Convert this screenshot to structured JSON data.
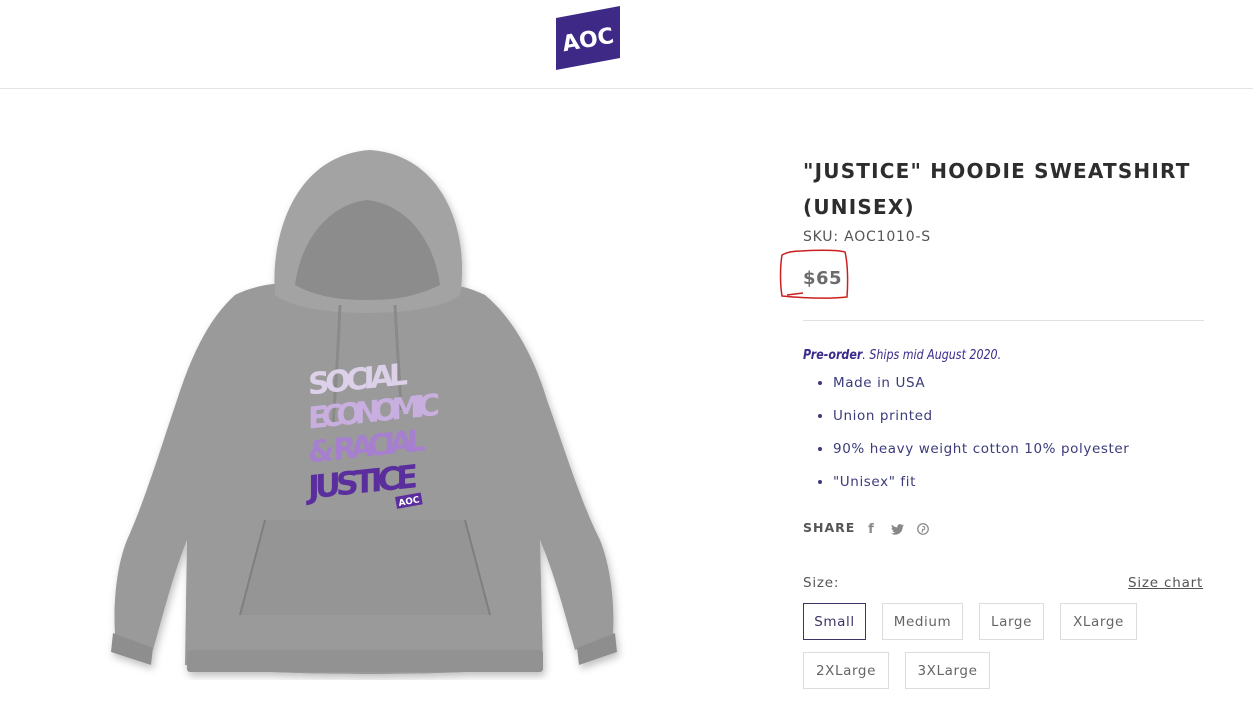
{
  "brand": {
    "logo_text": "AOC",
    "color": "#3e2a86"
  },
  "product": {
    "title": "\"JUSTICE\" HOODIE SWEATSHIRT (UNISEX)",
    "sku": "SKU: AOC1010-S",
    "price": "$65",
    "preorder_strong": "Pre-order",
    "preorder_rest": ". Ships mid August 2020.",
    "features": [
      "Made in USA",
      "Union printed",
      "90% heavy weight cotton 10% polyester",
      "\"Unisex\" fit"
    ],
    "print_lines": [
      "SOCIAL",
      "ECONOMIC",
      "& RACIAL",
      "JUSTICE"
    ],
    "print_badge": "AOC"
  },
  "share": {
    "label": "SHARE",
    "icons": [
      "facebook-icon",
      "twitter-icon",
      "pinterest-icon"
    ],
    "facebook_glyph": "f"
  },
  "size": {
    "label": "Size:",
    "chart_link": "Size chart",
    "options": [
      "Small",
      "Medium",
      "Large",
      "XLarge",
      "2XLarge",
      "3XLarge"
    ],
    "selected": "Small"
  },
  "annotation": {
    "color": "#cc1f1f"
  }
}
